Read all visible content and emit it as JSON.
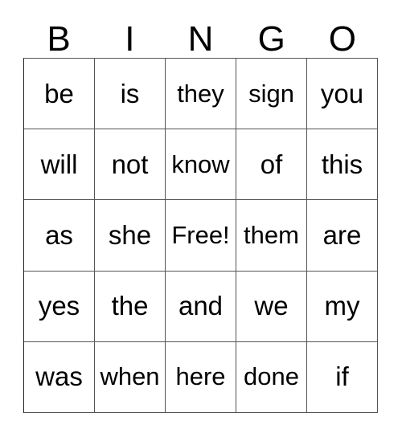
{
  "card": {
    "title": "BINGO",
    "free_space_label": "Free!",
    "colors": {
      "text": "#000000",
      "grid_line": "#555555",
      "background": "#ffffff"
    },
    "header": {
      "letters": [
        "B",
        "I",
        "N",
        "G",
        "O"
      ]
    },
    "grid": {
      "columns": 5,
      "rows": 5,
      "cells": [
        [
          "be",
          "is",
          "they",
          "sign",
          "you"
        ],
        [
          "will",
          "not",
          "know",
          "of",
          "this"
        ],
        [
          "as",
          "she",
          "Free!",
          "them",
          "are"
        ],
        [
          "yes",
          "the",
          "and",
          "we",
          "my"
        ],
        [
          "was",
          "when",
          "here",
          "done",
          "if"
        ]
      ]
    }
  }
}
